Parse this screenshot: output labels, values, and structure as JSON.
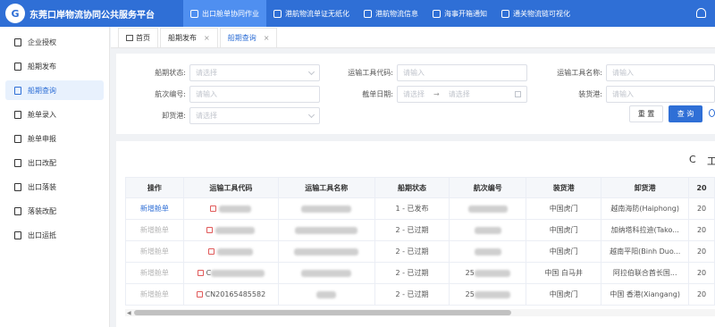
{
  "app": {
    "logo_mark": "G",
    "title": "东莞口岸物流协同公共服务平台"
  },
  "nav": [
    {
      "label": "出口舱单协同作业",
      "active": true
    },
    {
      "label": "港航物流单证无纸化",
      "active": false
    },
    {
      "label": "港航物流信息",
      "active": false
    },
    {
      "label": "海事开箱通知",
      "active": false
    },
    {
      "label": "通关物流链可视化",
      "active": false
    }
  ],
  "sidebar": {
    "items": [
      {
        "label": "企业授权",
        "active": false
      },
      {
        "label": "船期发布",
        "active": false
      },
      {
        "label": "船期查询",
        "active": true
      },
      {
        "label": "舱单录入",
        "active": false
      },
      {
        "label": "舱单申报",
        "active": false
      },
      {
        "label": "出口改配",
        "active": false
      },
      {
        "label": "出口落装",
        "active": false
      },
      {
        "label": "落装改配",
        "active": false
      },
      {
        "label": "出口运抵",
        "active": false
      }
    ]
  },
  "tabs": {
    "home": "首页",
    "items": [
      {
        "label": "船期发布",
        "close": "×"
      },
      {
        "label": "船期查询",
        "close": "×"
      }
    ]
  },
  "form": {
    "ship_status_label": "船期状态:",
    "ship_status_placeholder": "请选择",
    "transport_code_label": "运输工具代码:",
    "transport_code_placeholder": "请输入",
    "transport_name_label": "运输工具名称:",
    "transport_name_placeholder": "请输入",
    "voyage_label": "航次编号:",
    "voyage_placeholder": "请输入",
    "cutoff_label": "截单日期:",
    "cutoff_start_placeholder": "请选择",
    "cutoff_sep": "→",
    "cutoff_end_placeholder": "请选择",
    "load_port_label": "装货港:",
    "load_port_placeholder": "请输入",
    "unload_port_label": "卸货港:",
    "unload_port_placeholder": "请选择",
    "reset_label": "重 置",
    "query_label": "查 询"
  },
  "toolbar": {
    "refresh_icon": "C",
    "column_icon": "工"
  },
  "table": {
    "columns": [
      "操作",
      "运输工具代码",
      "运输工具名称",
      "船期状态",
      "航次编号",
      "装货港",
      "卸货港",
      "20"
    ],
    "rows": [
      {
        "op": "新增舱单",
        "op_enabled": true,
        "code": "",
        "name": "",
        "status": "1 - 已发布",
        "voyage": "",
        "load_port": "中国虎门",
        "unload_port": "越南海防(Haiphong)",
        "extra": "20"
      },
      {
        "op": "新增舱单",
        "op_enabled": false,
        "code": "",
        "name": "",
        "status": "2 - 已过期",
        "voyage": "",
        "load_port": "中国虎门",
        "unload_port": "加纳塔科拉迪(Tako...",
        "extra": "20"
      },
      {
        "op": "新增舱单",
        "op_enabled": false,
        "code": "",
        "name": "",
        "status": "2 - 已过期",
        "voyage": "",
        "load_port": "中国虎门",
        "unload_port": "越南平阳(Binh Duo...",
        "extra": "20"
      },
      {
        "op": "新增舱单",
        "op_enabled": false,
        "code": "C",
        "name": "",
        "status": "2 - 已过期",
        "voyage": "25",
        "load_port": "中国 白马井",
        "unload_port": "阿拉伯联合酋长国...",
        "extra": "20"
      },
      {
        "op": "新增舱单",
        "op_enabled": false,
        "code": "CN20165485582",
        "name": "",
        "status": "2 - 已过期",
        "voyage": "25",
        "load_port": "中国虎门",
        "unload_port": "中国 香港(Xiangang)",
        "extra": "20"
      }
    ]
  },
  "colors": {
    "primary": "#2f6fd6",
    "nav_active": "#4f8ff0"
  }
}
